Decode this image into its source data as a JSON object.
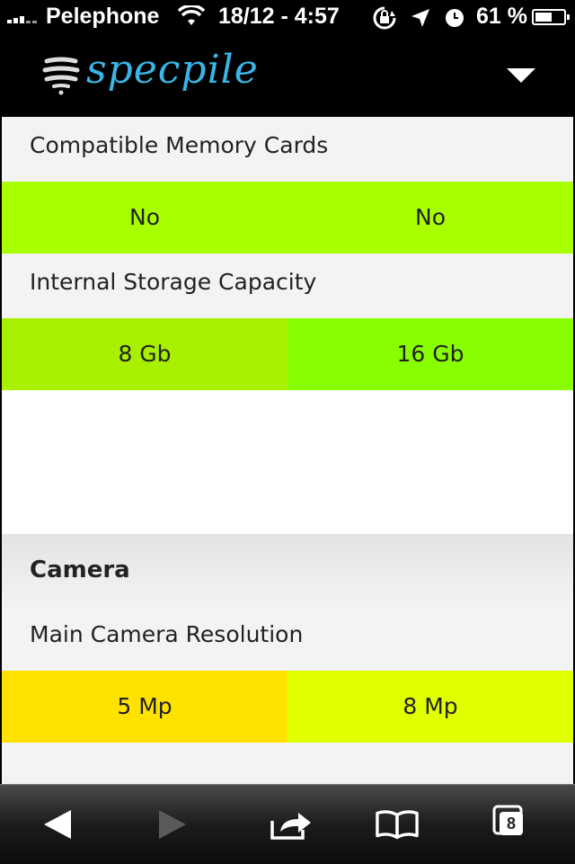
{
  "status_bar": {
    "carrier": "Pelephone",
    "time": "18/12 - 4:57",
    "battery_percent": "61 %",
    "battery_level": 0.61
  },
  "app": {
    "logo_text": "specpile",
    "brand_color": "#39b6e6",
    "menu_icon": "dropdown-triangle-icon"
  },
  "specs": [
    {
      "label": "Compatible Memory Cards",
      "values": [
        {
          "text": "No",
          "color": "#a8ff00"
        },
        {
          "text": "No",
          "color": "#a8ff00"
        }
      ]
    },
    {
      "label": "Internal Storage Capacity",
      "values": [
        {
          "text": "8 Gb",
          "color": "#a8f000"
        },
        {
          "text": "16 Gb",
          "color": "#88ff00"
        }
      ]
    }
  ],
  "camera_section": {
    "title": "Camera",
    "specs": [
      {
        "label": "Main Camera Resolution",
        "values": [
          {
            "text": "5 Mp",
            "color": "#ffe200"
          },
          {
            "text": "8 Mp",
            "color": "#e2ff00"
          }
        ]
      }
    ]
  },
  "toolbar": {
    "tab_count": "8",
    "icons": [
      "back-icon",
      "forward-icon",
      "share-icon",
      "bookmarks-icon",
      "tabs-icon"
    ]
  }
}
